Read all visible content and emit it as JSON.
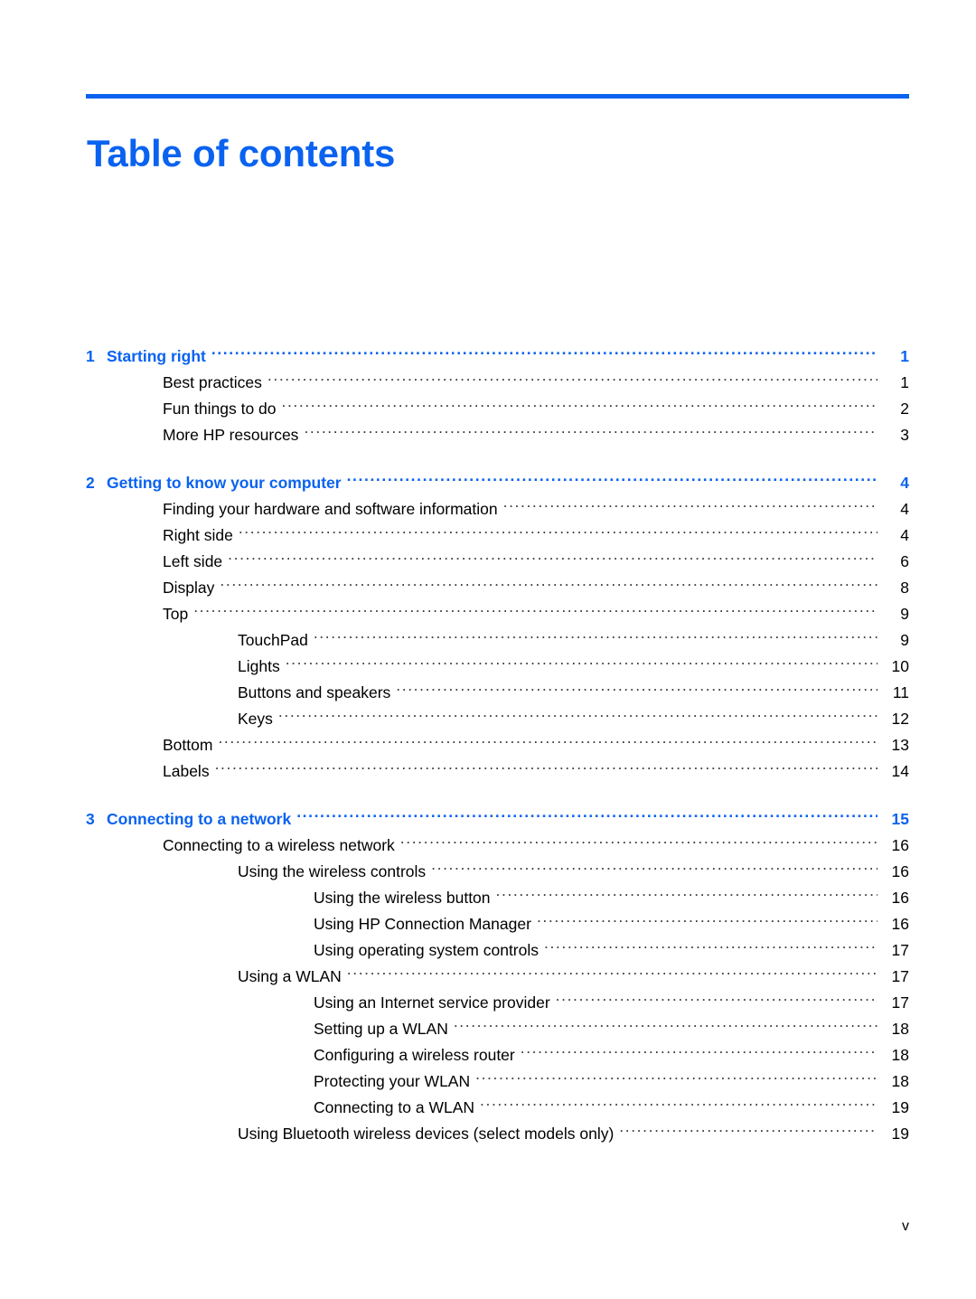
{
  "document": {
    "title": "Table of contents",
    "accent_color": "#0a62f0",
    "footer_page_number": "v"
  },
  "toc": {
    "entries": [
      {
        "level": 1,
        "number": "1",
        "label": "Starting right",
        "page": "1"
      },
      {
        "level": 2,
        "number": "",
        "label": "Best practices",
        "page": "1"
      },
      {
        "level": 2,
        "number": "",
        "label": "Fun things to do",
        "page": "2"
      },
      {
        "level": 2,
        "number": "",
        "label": "More HP resources",
        "page": "3"
      },
      {
        "level": 1,
        "number": "2",
        "label": "Getting to know your computer",
        "page": "4"
      },
      {
        "level": 2,
        "number": "",
        "label": "Finding your hardware and software information",
        "page": "4"
      },
      {
        "level": 2,
        "number": "",
        "label": "Right side",
        "page": "4"
      },
      {
        "level": 2,
        "number": "",
        "label": "Left side",
        "page": "6"
      },
      {
        "level": 2,
        "number": "",
        "label": "Display",
        "page": "8"
      },
      {
        "level": 2,
        "number": "",
        "label": "Top",
        "page": "9"
      },
      {
        "level": 3,
        "number": "",
        "label": "TouchPad",
        "page": "9"
      },
      {
        "level": 3,
        "number": "",
        "label": "Lights",
        "page": "10"
      },
      {
        "level": 3,
        "number": "",
        "label": "Buttons and speakers",
        "page": "11"
      },
      {
        "level": 3,
        "number": "",
        "label": "Keys",
        "page": "12"
      },
      {
        "level": 2,
        "number": "",
        "label": "Bottom",
        "page": "13"
      },
      {
        "level": 2,
        "number": "",
        "label": "Labels",
        "page": "14"
      },
      {
        "level": 1,
        "number": "3",
        "label": "Connecting to a network",
        "page": "15"
      },
      {
        "level": 2,
        "number": "",
        "label": "Connecting to a wireless network",
        "page": "16"
      },
      {
        "level": 3,
        "number": "",
        "label": "Using the wireless controls",
        "page": "16"
      },
      {
        "level": 4,
        "number": "",
        "label": "Using the wireless button",
        "page": "16"
      },
      {
        "level": 4,
        "number": "",
        "label": "Using HP Connection Manager",
        "page": "16"
      },
      {
        "level": 4,
        "number": "",
        "label": "Using operating system controls",
        "page": "17"
      },
      {
        "level": 3,
        "number": "",
        "label": "Using a WLAN",
        "page": "17"
      },
      {
        "level": 4,
        "number": "",
        "label": "Using an Internet service provider",
        "page": "17"
      },
      {
        "level": 4,
        "number": "",
        "label": "Setting up a WLAN",
        "page": "18"
      },
      {
        "level": 4,
        "number": "",
        "label": "Configuring a wireless router",
        "page": "18"
      },
      {
        "level": 4,
        "number": "",
        "label": "Protecting your WLAN",
        "page": "18"
      },
      {
        "level": 4,
        "number": "",
        "label": "Connecting to a WLAN",
        "page": "19"
      },
      {
        "level": 3,
        "number": "",
        "label": "Using Bluetooth wireless devices (select models only)",
        "page": "19"
      }
    ]
  }
}
